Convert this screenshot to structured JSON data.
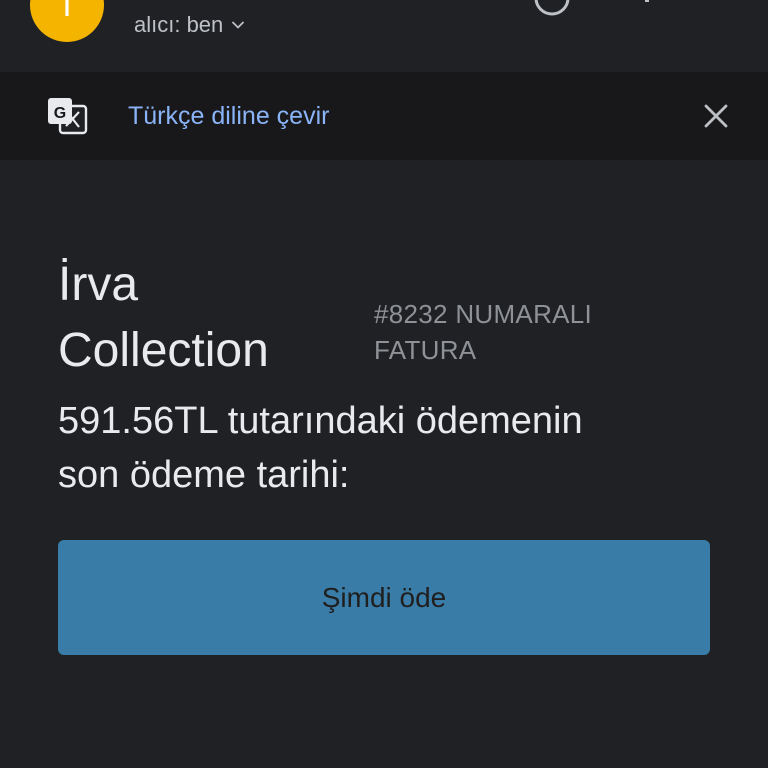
{
  "header": {
    "avatar_letter": "T",
    "recipient_label": "alıcı: ben"
  },
  "translate_bar": {
    "link_label": "Türkçe diline çevir"
  },
  "email": {
    "brand_line1": "İrva",
    "brand_line2": "Collection",
    "invoice_line1": "#8232 NUMARALI",
    "invoice_line2": "FATURA",
    "message_line1": "591.56TL tutarındaki ödemenin",
    "message_line2": "son ödeme tarihi:",
    "pay_button_label": "Şimdi öde"
  },
  "colors": {
    "background": "#202124",
    "translate_bar_bg": "#18181a",
    "link": "#8ab4f8",
    "button": "#3a7ca8",
    "avatar": "#f4b400"
  },
  "icons": {
    "translate": "google-translate-icon",
    "close": "close-icon",
    "chevron": "chevron-down-icon"
  }
}
